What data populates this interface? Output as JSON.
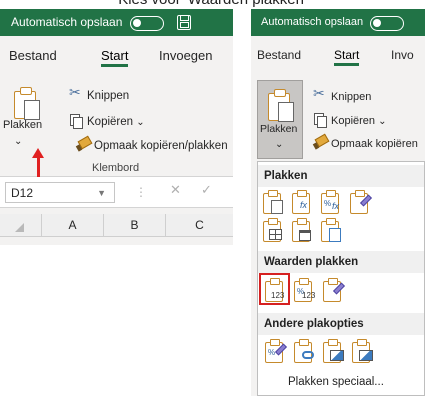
{
  "caption": "Kies voor 'Waarden plakken'",
  "left": {
    "title": "Automatisch opslaan",
    "tabs": [
      "Bestand",
      "Start",
      "Invoegen"
    ],
    "ribbon": {
      "paste_label": "Plakken",
      "cut_label": "Knippen",
      "copy_label": "Kopiëren",
      "format_painter_label": "Opmaak kopiëren/plakken",
      "group_label": "Klembord"
    },
    "name_box": "D12",
    "formula_cancel": "✕",
    "formula_enter": "✓",
    "columns": [
      "A",
      "B",
      "C"
    ]
  },
  "right": {
    "title": "Automatisch opslaan",
    "tabs": [
      "Bestand",
      "Start",
      "Invo"
    ],
    "ribbon": {
      "paste_label": "Plakken",
      "cut_label": "Knippen",
      "copy_label": "Kopiëren",
      "format_painter_label": "Opmaak kopiëren"
    },
    "gallery": {
      "sections": [
        "Plakken",
        "Waarden plakken",
        "Andere plakopties"
      ],
      "paste_special": "Plakken speciaal..."
    }
  },
  "colors": {
    "excel_green": "#217346",
    "highlight_red": "#d62020",
    "arrow_red": "#e02020"
  }
}
